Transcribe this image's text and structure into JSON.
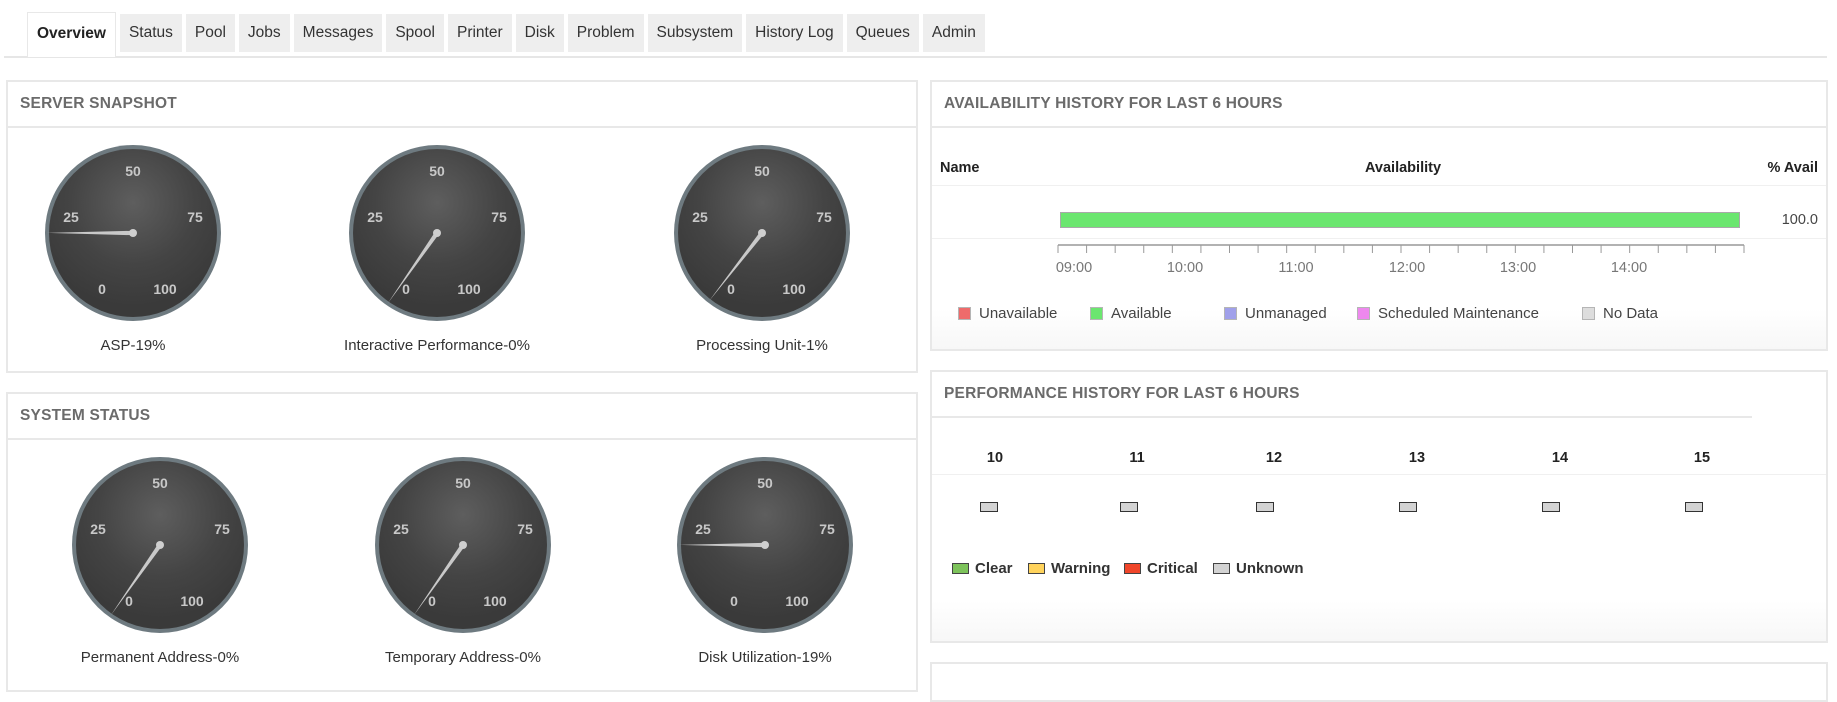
{
  "tabs": [
    {
      "label": "Overview",
      "active": true
    },
    {
      "label": "Status",
      "active": false
    },
    {
      "label": "Pool",
      "active": false
    },
    {
      "label": "Jobs",
      "active": false
    },
    {
      "label": "Messages",
      "active": false
    },
    {
      "label": "Spool",
      "active": false
    },
    {
      "label": "Printer",
      "active": false
    },
    {
      "label": "Disk",
      "active": false
    },
    {
      "label": "Problem",
      "active": false
    },
    {
      "label": "Subsystem",
      "active": false
    },
    {
      "label": "History Log",
      "active": false
    },
    {
      "label": "Queues",
      "active": false
    },
    {
      "label": "Admin",
      "active": false
    }
  ],
  "server_snapshot": {
    "title": "SERVER SNAPSHOT",
    "gauges": [
      {
        "name": "ASP",
        "value": 19,
        "label": "ASP-19%"
      },
      {
        "name": "Interactive Performance",
        "value": 0,
        "label": "Interactive Performance-0%"
      },
      {
        "name": "Processing Unit",
        "value": 1,
        "label": "Processing Unit-1%"
      }
    ]
  },
  "system_status": {
    "title": "SYSTEM STATUS",
    "gauges": [
      {
        "name": "Permanent Address",
        "value": 0,
        "label": "Permanent Address-0%"
      },
      {
        "name": "Temporary Address",
        "value": 0,
        "label": "Temporary Address-0%"
      },
      {
        "name": "Disk Utilization",
        "value": 19,
        "label": "Disk Utilization-19%"
      }
    ]
  },
  "gauge_scale": {
    "ticks": [
      "0",
      "25",
      "50",
      "75",
      "100"
    ],
    "min": 0,
    "max": 100
  },
  "availability": {
    "title": "AVAILABILITY HISTORY FOR LAST 6 HOURS",
    "headers": {
      "name": "Name",
      "availability": "Availability",
      "pct": "% Avail"
    },
    "rows": [
      {
        "name": "",
        "status": "Available",
        "percent": "100.0"
      }
    ],
    "axis_labels": [
      "09:00",
      "10:00",
      "11:00",
      "12:00",
      "13:00",
      "14:00"
    ],
    "legend": [
      {
        "label": "Unavailable",
        "color": "#ee6b6b"
      },
      {
        "label": "Available",
        "color": "#6be66f"
      },
      {
        "label": "Unmanaged",
        "color": "#a0a0ea"
      },
      {
        "label": "Scheduled Maintenance",
        "color": "#ee88ee"
      },
      {
        "label": "No Data",
        "color": "#dddddd"
      }
    ]
  },
  "performance": {
    "title": "PERFORMANCE HISTORY FOR LAST 6 HOURS",
    "hours": [
      "10",
      "11",
      "12",
      "13",
      "14",
      "15"
    ],
    "statuses": [
      "Unknown",
      "Unknown",
      "Unknown",
      "Unknown",
      "Unknown",
      "Unknown"
    ],
    "legend": [
      {
        "label": "Clear",
        "color": "#7dc35b"
      },
      {
        "label": "Warning",
        "color": "#ffd35c"
      },
      {
        "label": "Critical",
        "color": "#f0462a"
      },
      {
        "label": "Unknown",
        "color": "#d3d3d3"
      }
    ]
  }
}
